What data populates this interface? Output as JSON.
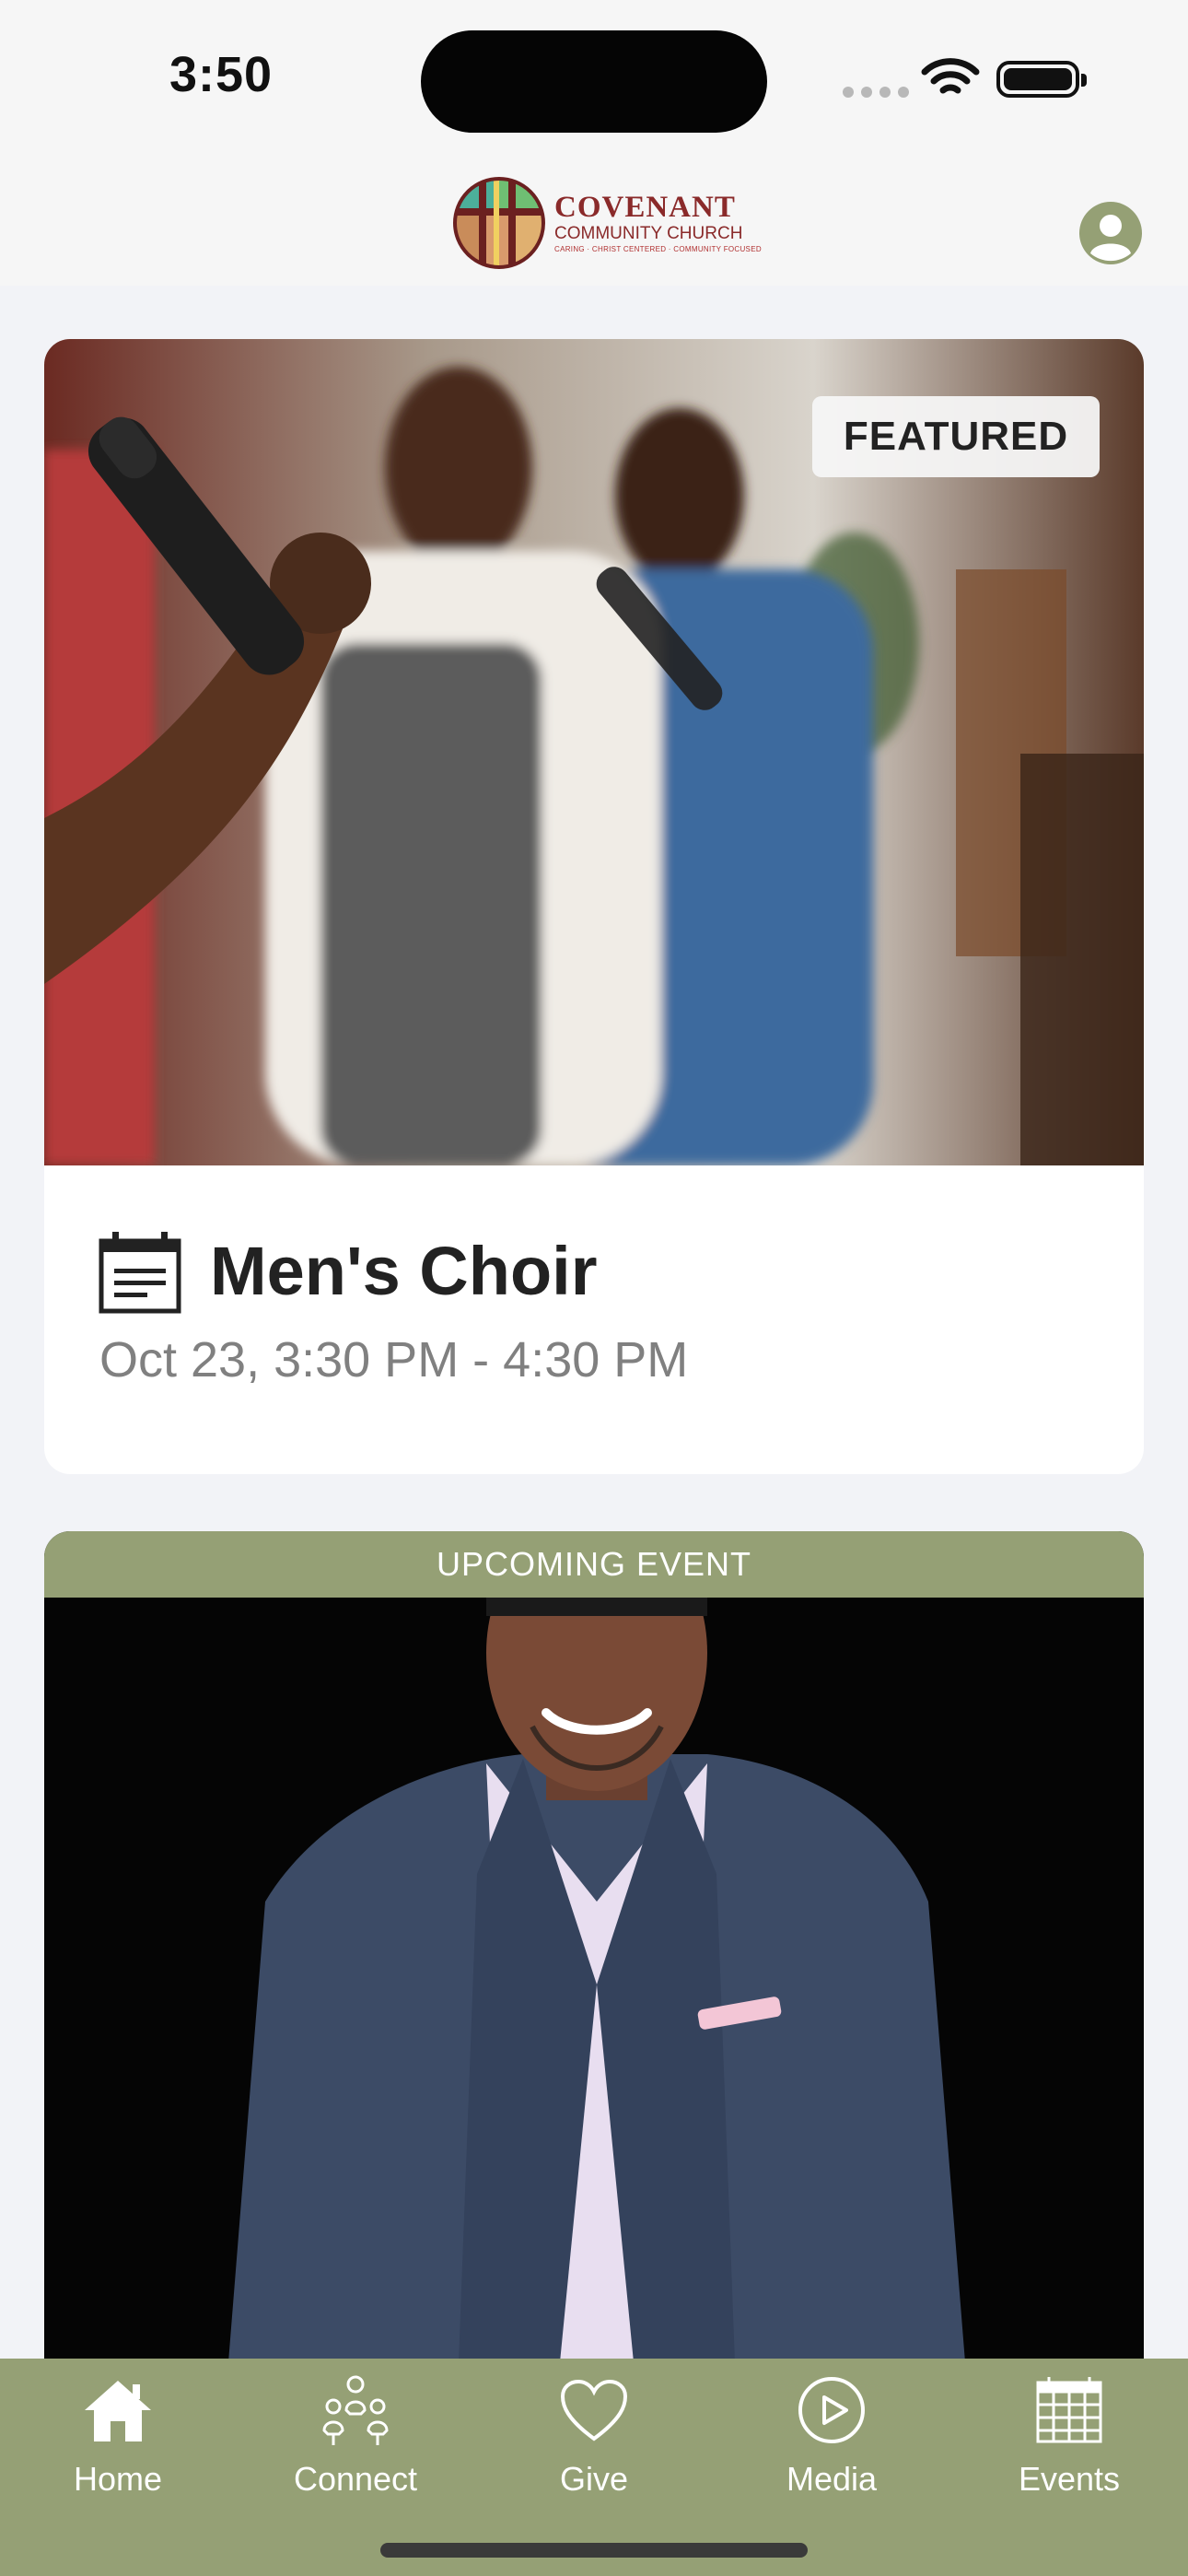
{
  "status_bar": {
    "time": "3:50"
  },
  "header": {
    "logo": {
      "title": "COVENANT",
      "subtitle": "COMMUNITY CHURCH",
      "tagline": "CARING · CHRIST CENTERED · COMMUNITY FOCUSED"
    },
    "profile_icon": "person-circle-icon"
  },
  "featured": {
    "badge": "FEATURED",
    "title": "Men's Choir",
    "time": "Oct 23, 3:30 PM - 4:30 PM",
    "icon": "calendar-icon"
  },
  "upcoming": {
    "label": "UPCOMING EVENT"
  },
  "tabs": [
    {
      "label": "Home",
      "icon": "home-icon"
    },
    {
      "label": "Connect",
      "icon": "people-icon"
    },
    {
      "label": "Give",
      "icon": "heart-icon"
    },
    {
      "label": "Media",
      "icon": "play-icon"
    },
    {
      "label": "Events",
      "icon": "calendar-grid-icon"
    }
  ],
  "colors": {
    "accent": "#95a075",
    "background": "#f2f3f7",
    "logo_red": "#8a2a2a"
  }
}
